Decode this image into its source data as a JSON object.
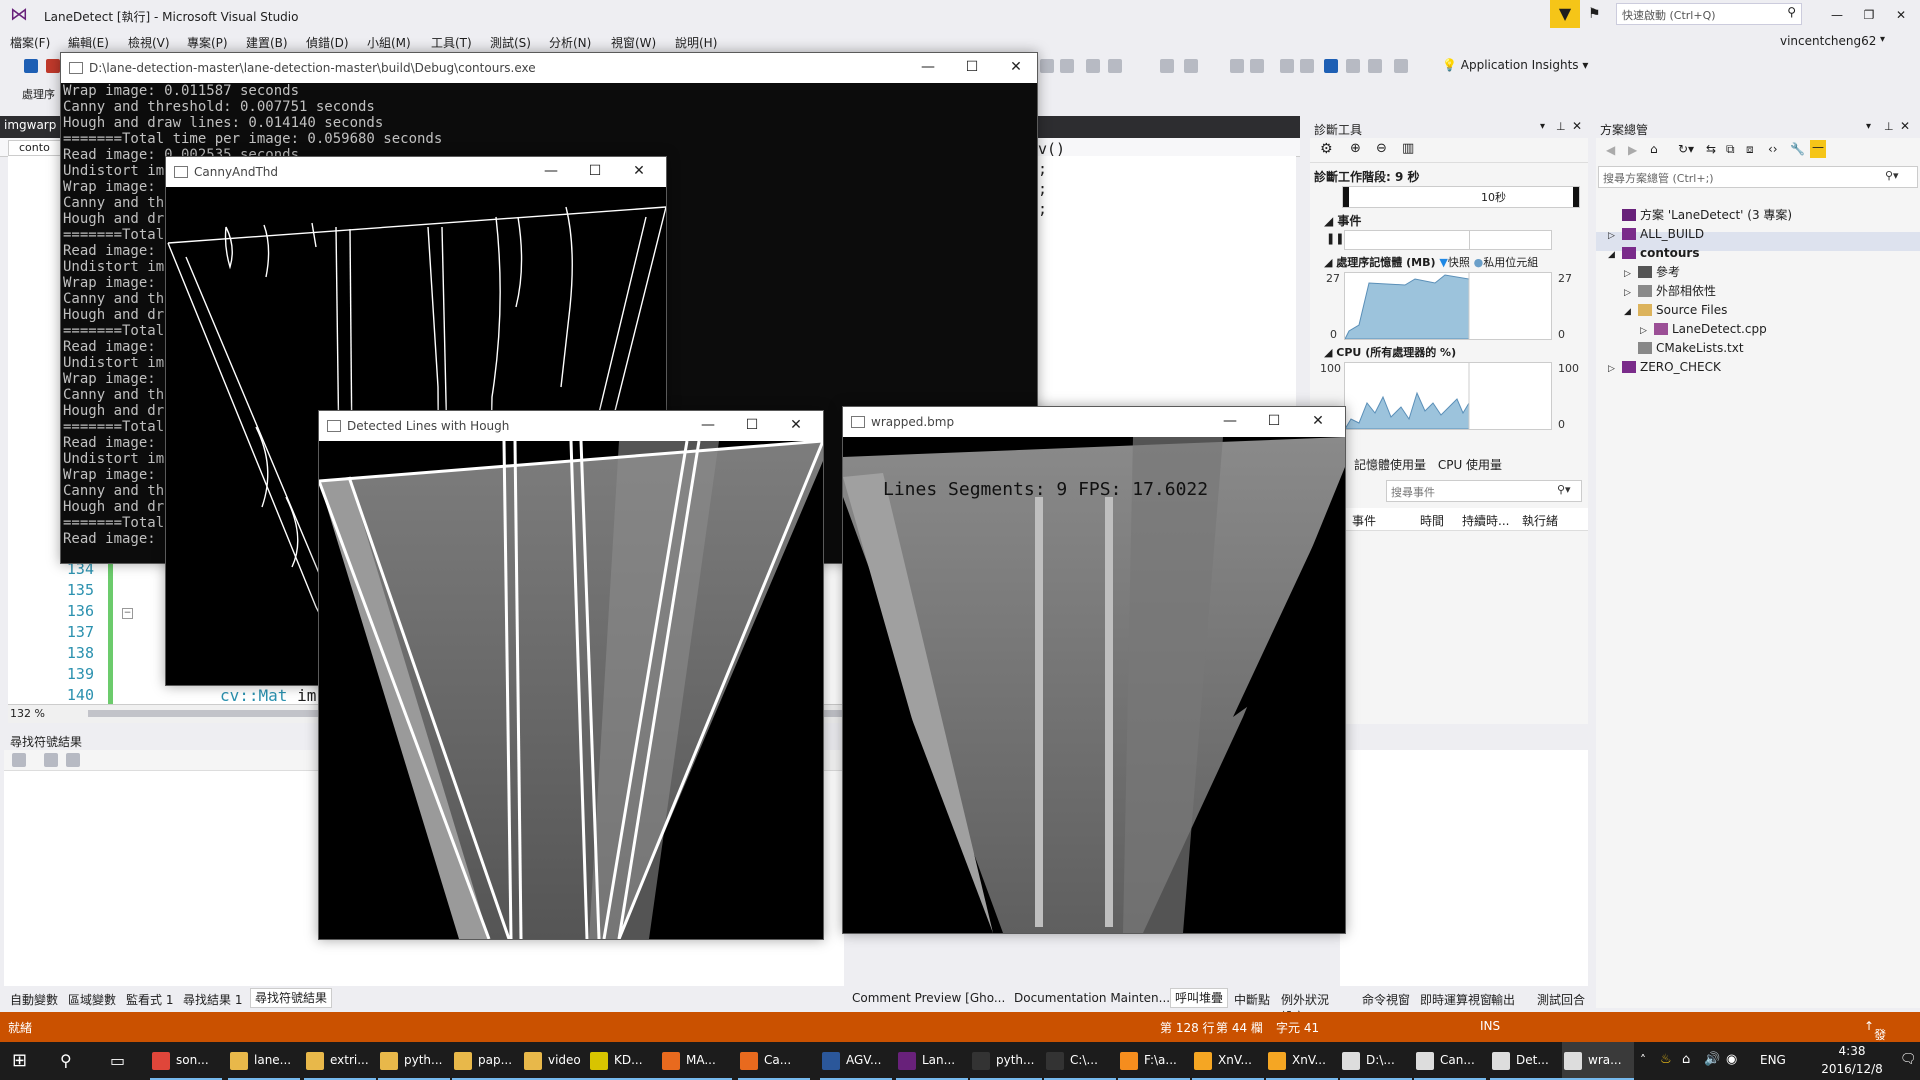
{
  "vs": {
    "title": "LaneDetect [執行] - Microsoft Visual Studio",
    "quick_launch_placeholder": "快速啟動 (Ctrl+Q)",
    "user": "vincentcheng62",
    "menu": [
      "檔案(F)",
      "編輯(E)",
      "檢視(V)",
      "專案(P)",
      "建置(B)",
      "偵錯(D)",
      "小組(M)",
      "工具(T)",
      "測試(S)",
      "分析(N)",
      "視窗(W)",
      "說明(H)"
    ],
    "application_insights": "Application Insights",
    "toolbar2_label": "處理序",
    "editor_tab": "imgwarp",
    "editor_subtab": "conto",
    "line_numbers": [
      "134",
      "135",
      "136",
      "137",
      "138",
      "139",
      "140"
    ],
    "code_140_type": "cv::Mat",
    "code_140_rest": " im",
    "zoom": "132 %",
    "right_code_1": "v()",
    "right_code_2": ";",
    "right_code_3": ";",
    "right_code_4": ";"
  },
  "find_panel": {
    "title": "尋找符號結果"
  },
  "bottom_tabs": [
    "自動變數",
    "區域變數",
    "監看式 1",
    "尋找結果 1",
    "尋找符號結果"
  ],
  "bottom_tabs_right": [
    "Comment Preview [Gho...",
    "Documentation Mainten...",
    "呼叫堆疊",
    "中斷點",
    "例外狀況設定",
    "命令視窗",
    "即時運算視窗",
    "輸出",
    "測試回合"
  ],
  "diagnostics": {
    "title": "診斷工具",
    "session": "診斷工作階段: 9 秒",
    "timeline_mark": "10秒",
    "events_label": "事件",
    "memory_label": "處理序記憶體 (MB)",
    "memory_legend_1": "快照",
    "memory_legend_2": "私用位元組",
    "memory_max": "27",
    "memory_min": "0",
    "cpu_label": "CPU (所有處理器的 %)",
    "cpu_max": "100",
    "cpu_min": "0",
    "subtab_1": "記憶體使用量",
    "subtab_2": "CPU 使用量",
    "search_placeholder": "搜尋事件",
    "col_1": "事件",
    "col_2": "時間",
    "col_3": "持續時...",
    "col_4": "執行緒",
    "colors": {
      "memory_fill": "#9cc3dc",
      "cpu_fill": "#9cc3dc"
    }
  },
  "solution_explorer": {
    "title": "方案總管",
    "search_placeholder": "搜尋方案總管 (Ctrl+;)",
    "items": [
      {
        "label": "方案 'LaneDetect' (3 專案)",
        "depth": 0,
        "icon": "solution-icon"
      },
      {
        "label": "ALL_BUILD",
        "depth": 0,
        "icon": "project-icon",
        "expander": "▷"
      },
      {
        "label": "contours",
        "depth": 0,
        "icon": "project-icon",
        "expander": "◢",
        "selected": true
      },
      {
        "label": "參考",
        "depth": 1,
        "icon": "references-icon",
        "expander": "▷"
      },
      {
        "label": "外部相依性",
        "depth": 1,
        "icon": "external-deps-icon",
        "expander": "▷"
      },
      {
        "label": "Source Files",
        "depth": 1,
        "icon": "folder-icon",
        "expander": "◢"
      },
      {
        "label": "LaneDetect.cpp",
        "depth": 2,
        "icon": "cpp-file-icon",
        "expander": "▷"
      },
      {
        "label": "CMakeLists.txt",
        "depth": 1,
        "icon": "text-file-icon"
      },
      {
        "label": "ZERO_CHECK",
        "depth": 0,
        "icon": "project-icon",
        "expander": "▷"
      }
    ]
  },
  "status_bar": {
    "ready": "就緒",
    "line": "第 128 行",
    "col": "第 44 欄",
    "char": "字元 41",
    "mode": "INS",
    "publish": "發行",
    "color": "#ca5100"
  },
  "console": {
    "title": "D:\\lane-detection-master\\lane-detection-master\\build\\Debug\\contours.exe",
    "lines": [
      "Wrap image: 0.011587 seconds",
      "Canny and threshold: 0.007751 seconds",
      "Hough and draw lines: 0.014140 seconds",
      "=======Total time per image: 0.059680 seconds",
      "Read image: 0.002535 seconds",
      "Undistort ima",
      "Wrap image: 0",
      "Canny and thr",
      "Hough and dra",
      "=======Total",
      "Read image: 0",
      "Undistort ima",
      "Wrap image: 0",
      "Canny and thr",
      "Hough and dra",
      "=======Total",
      "Read image: 0",
      "Undistort ima",
      "Wrap image: 0",
      "Canny and thr",
      "Hough and dra",
      "=======Total",
      "Read image: 0",
      "Undistort ima",
      "Wrap image: 0",
      "Canny and thr",
      "Hough and dra",
      "=======Total",
      "Read image: 0"
    ]
  },
  "canny_window": {
    "title": "CannyAndThd"
  },
  "hough_window": {
    "title": "Detected Lines with Hough"
  },
  "wrapped_window": {
    "title": "wrapped.bmp",
    "overlay_text": "Lines Segments: 9 FPS: 17.6022"
  },
  "taskbar": {
    "items": [
      {
        "label": "son...",
        "icon": "chrome-icon",
        "color": "#e0463a"
      },
      {
        "label": "lane...",
        "icon": "folder-icon",
        "color": "#e8b84a"
      },
      {
        "label": "extri...",
        "icon": "folder-icon",
        "color": "#e8b84a"
      },
      {
        "label": "pyth...",
        "icon": "folder-icon",
        "color": "#e8b84a"
      },
      {
        "label": "pap...",
        "icon": "folder-icon",
        "color": "#e8b84a"
      },
      {
        "label": "video",
        "icon": "folder-icon",
        "color": "#e8b84a"
      },
      {
        "label": "KD...",
        "icon": "kd-icon",
        "color": "#d8c400"
      },
      {
        "label": "MA...",
        "icon": "matlab-icon",
        "color": "#e86a1e"
      },
      {
        "label": "Ca...",
        "icon": "matlab-icon",
        "color": "#e86a1e"
      },
      {
        "label": "AGV...",
        "icon": "word-icon",
        "color": "#2b579a"
      },
      {
        "label": "Lan...",
        "icon": "visual-studio-icon",
        "color": "#68217a"
      },
      {
        "label": "pyth...",
        "icon": "console-icon",
        "color": "#333333"
      },
      {
        "label": "C:\\...",
        "icon": "console-icon",
        "color": "#333333"
      },
      {
        "label": "F:\\a...",
        "icon": "sublime-icon",
        "color": "#f58d1e"
      },
      {
        "label": "XnV...",
        "icon": "xnview-icon",
        "color": "#f5a623"
      },
      {
        "label": "XnV...",
        "icon": "xnview-icon",
        "color": "#f5a623"
      },
      {
        "label": "D:\\...",
        "icon": "window-icon",
        "color": "#dddddd"
      },
      {
        "label": "Can...",
        "icon": "window-icon",
        "color": "#dddddd"
      },
      {
        "label": "Det...",
        "icon": "window-icon",
        "color": "#dddddd"
      },
      {
        "label": "wra...",
        "icon": "window-icon",
        "color": "#dddddd",
        "active": true
      }
    ],
    "lang": "ENG",
    "time": "4:38",
    "date": "2016/12/8"
  }
}
